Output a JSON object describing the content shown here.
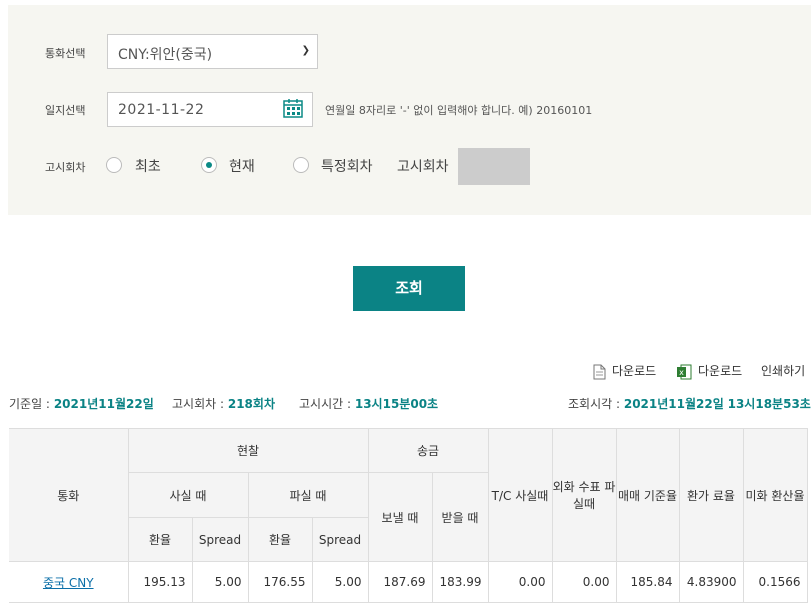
{
  "filter": {
    "currency_label": "통화선택",
    "currency_value": "CNY:위안(중국)",
    "date_label": "일지선택",
    "date_value": "2021-11-22",
    "date_hint": "연월일 8자리로 '-' 없이 입력해야 합니다. 예) 20160101",
    "round_label": "고시회차",
    "radios": [
      "최초",
      "현재",
      "특정회차"
    ],
    "round_inline_label": "고시회차",
    "search_button": "조회"
  },
  "tools": {
    "pdf_download": "다운로드",
    "excel_download": "다운로드",
    "print": "인쇄하기"
  },
  "info": {
    "base_date_label": "기준일 :",
    "base_date": "2021년11월22일",
    "round_label": "고시회차 :",
    "round": "218회차",
    "time_label": "고시시간 :",
    "time": "13시15분00초",
    "query_label": "조회시각 :",
    "query_date": "2021년11월22일",
    "query_time": "13시18분53초"
  },
  "table": {
    "h_currency": "통화",
    "h_cash": "현찰",
    "h_remit": "송금",
    "h_tc": "T/C 사실때",
    "h_foreign_check": "외화 수표 파실때",
    "h_base_rate": "매매 기준율",
    "h_conv": "환가 료율",
    "h_usd": "미화 환산율",
    "h_buy": "사실 때",
    "h_sell": "파실 때",
    "h_send": "보낼 때",
    "h_receive": "받을 때",
    "h_rate1": "환율",
    "h_spread1": "Spread",
    "h_rate2": "환율",
    "h_spread2": "Spread",
    "row": {
      "currency": "중국 CNY",
      "buy_rate": "195.13",
      "buy_spread": "5.00",
      "sell_rate": "176.55",
      "sell_spread": "5.00",
      "send": "187.69",
      "receive": "183.99",
      "tc": "0.00",
      "check": "0.00",
      "base": "185.84",
      "conv": "4.83900",
      "usd": "0.1566"
    }
  }
}
